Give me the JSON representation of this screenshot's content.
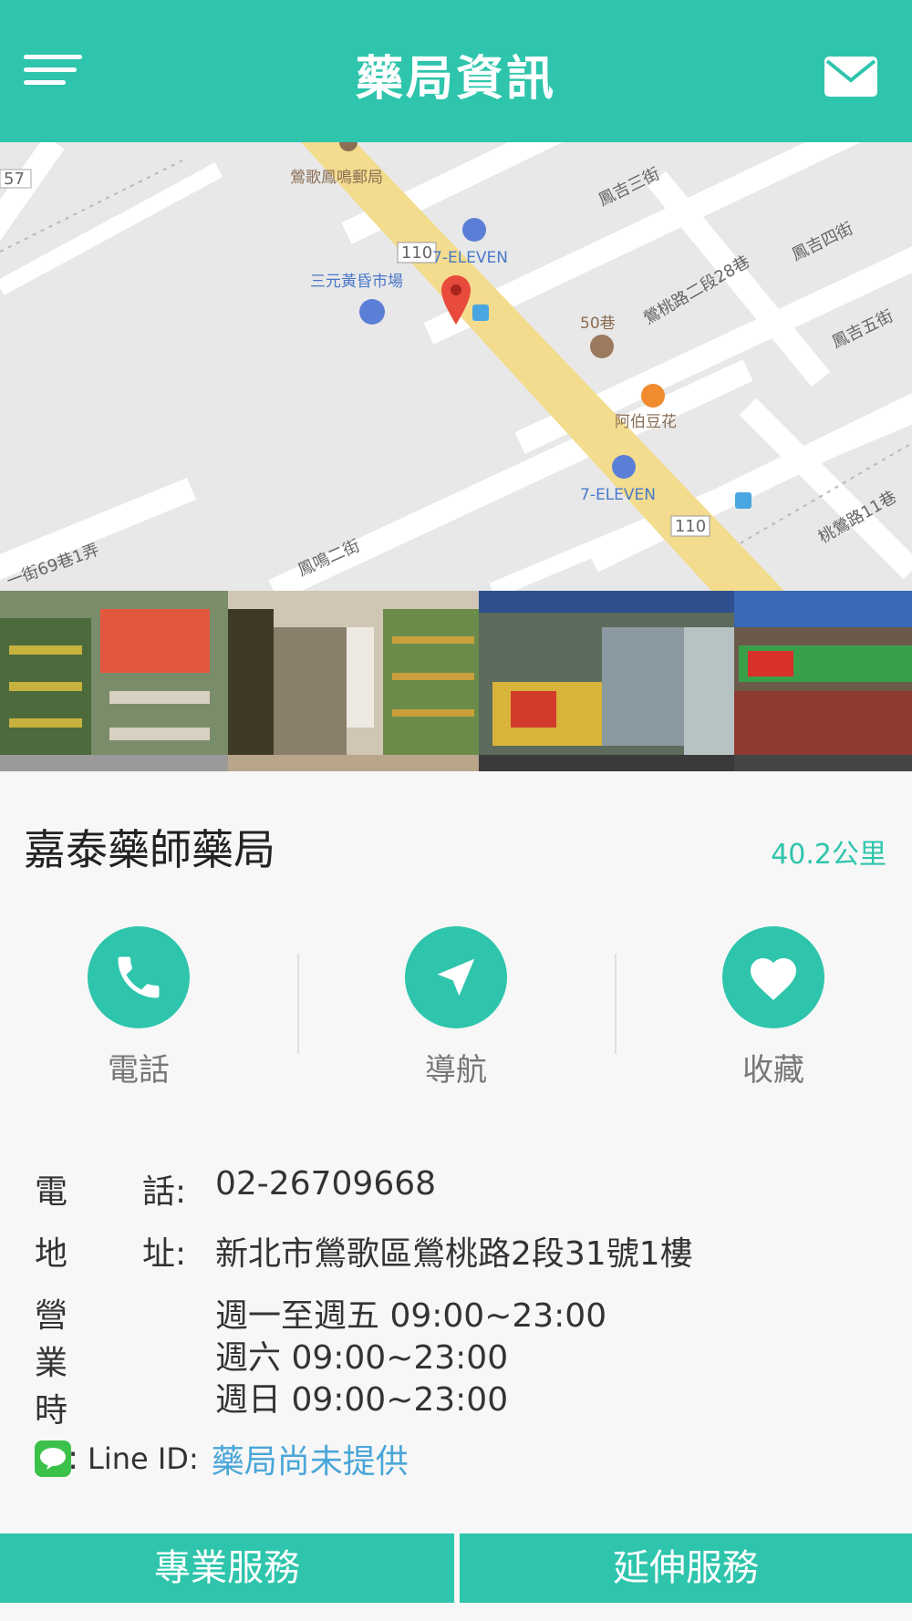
{
  "header": {
    "title": "藥局資訊"
  },
  "map": {
    "labels": {
      "post_office": "鶯歌鳳鳴郵局",
      "seven_top": "7-ELEVEN",
      "seven_bottom": "7-ELEVEN",
      "market": "三元黃昏市場",
      "alley50": "50巷",
      "tofu": "阿伯豆花",
      "road110_top": "110",
      "road110_bottom": "110",
      "fengji3": "鳳吉三街",
      "fengji4": "鳳吉四街",
      "fengji5": "鳳吉五街",
      "yingtao28": "鶯桃路二段28巷",
      "yingtao11": "桃鶯路11巷",
      "lane69": "一街69巷1弄",
      "fengming2": "鳳鳴二街",
      "tag57": "57"
    }
  },
  "store": {
    "name": "嘉泰藥師藥局",
    "distance": "40.2公里"
  },
  "actions": {
    "phone": "電話",
    "navigate": "導航",
    "favorite": "收藏"
  },
  "details": {
    "phone_label_1": "電",
    "phone_label_2": "話:",
    "phone": "02-26709668",
    "address_label_1": "地",
    "address_label_2": "址:",
    "address": "新北市鶯歌區鶯桃路2段31號1樓",
    "hours_label": "營業時間:",
    "hours": [
      "週一至週五 09:00~23:00",
      "週六 09:00~23:00",
      "週日 09:00~23:00"
    ],
    "line_label": "Line ID:",
    "line_value": "藥局尚未提供"
  },
  "bottom": {
    "professional": "專業服務",
    "extended": "延伸服務"
  },
  "colors": {
    "primary": "#2ec5ac",
    "link": "#4aa6d8",
    "line_green": "#3bc14a"
  },
  "icons": {
    "menu": "hamburger-icon",
    "mail": "mail-icon",
    "pin": "map-pin-icon",
    "phone": "phone-icon",
    "navigate": "navigation-arrow-icon",
    "favorite": "heart-icon",
    "line": "line-app-icon"
  }
}
